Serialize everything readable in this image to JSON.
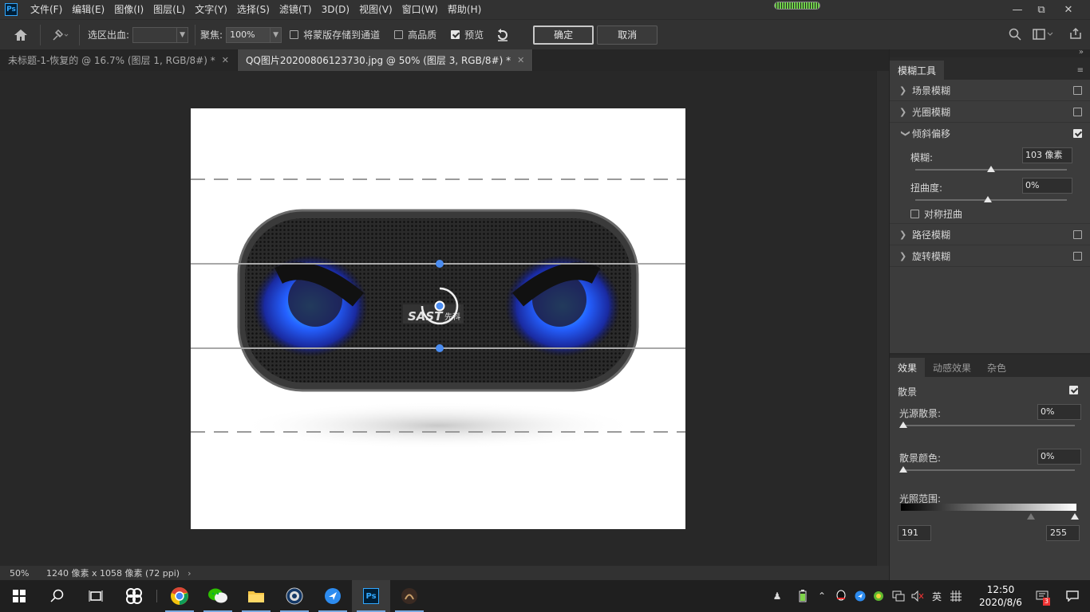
{
  "menu": {
    "app_icon": "Ps",
    "items": [
      "文件(F)",
      "编辑(E)",
      "图像(I)",
      "图层(L)",
      "文字(Y)",
      "选择(S)",
      "滤镜(T)",
      "3D(D)",
      "视图(V)",
      "窗口(W)",
      "帮助(H)"
    ],
    "window_controls": [
      "minimize-icon",
      "restore-icon",
      "close-icon"
    ],
    "progress_fraction": 1.0
  },
  "options": {
    "selection_bleed_label": "选区出血:",
    "selection_bleed_value": "",
    "focus_label": "聚焦:",
    "focus_value": "100%",
    "save_mask_label": "将蒙版存储到通道",
    "save_mask_checked": false,
    "high_quality_label": "高品质",
    "high_quality_checked": false,
    "preview_label": "预览",
    "preview_checked": true,
    "ok_label": "确定",
    "cancel_label": "取消"
  },
  "tabs": [
    {
      "label": "未标题-1-恢复的 @ 16.7% (图层 1, RGB/8#) *",
      "active": false
    },
    {
      "label": "QQ图片20200806123730.jpg @ 50% (图层 3, RGB/8#) *",
      "active": true
    }
  ],
  "status": {
    "zoom": "50%",
    "doc_size": "1240 像素 x 1058 像素 (72 ppi)"
  },
  "blur_panel": {
    "title": "模糊工具",
    "items": [
      {
        "label": "场景模糊",
        "checked": false,
        "expanded": false
      },
      {
        "label": "光圈模糊",
        "checked": false,
        "expanded": false
      },
      {
        "label": "倾斜偏移",
        "checked": true,
        "expanded": true
      },
      {
        "label": "路径模糊",
        "checked": false,
        "expanded": false
      },
      {
        "label": "旋转模糊",
        "checked": false,
        "expanded": false
      }
    ],
    "blur_label": "模糊:",
    "blur_value": "103 像素",
    "blur_slider": 0.5,
    "distortion_label": "扭曲度:",
    "distortion_value": "0%",
    "distortion_slider": 0.5,
    "symmetric_label": "对称扭曲",
    "symmetric_checked": false
  },
  "effects_panel": {
    "tabs": [
      "效果",
      "动感效果",
      "杂色"
    ],
    "bokeh_label": "散景",
    "bokeh_checked": true,
    "light_bokeh_label": "光源散景:",
    "light_bokeh_value": "0%",
    "bokeh_color_label": "散景颜色:",
    "bokeh_color_value": "0%",
    "light_range_label": "光照范围:",
    "range_low": "191",
    "range_high": "255"
  },
  "taskbar": {
    "time": "12:50",
    "date": "2020/8/6",
    "ime": "英",
    "notification_count": "3"
  },
  "colors": {
    "accent": "#4a8cf0",
    "ps_blue": "#31a8ff"
  }
}
